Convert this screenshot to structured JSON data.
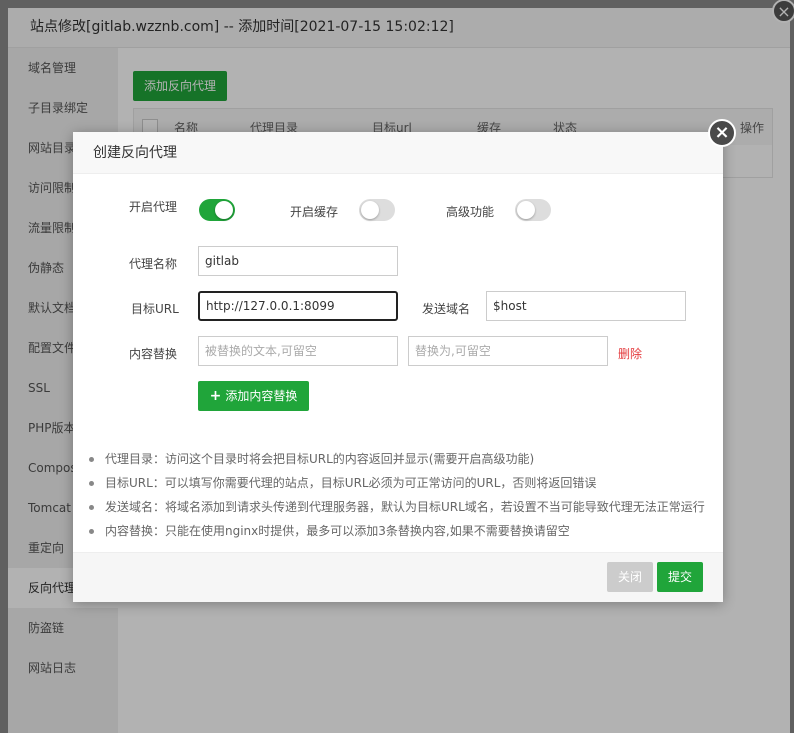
{
  "outer": {
    "title": "站点修改[gitlab.wzznb.com] -- 添加时间[2021-07-15 15:02:12]",
    "close_icon": "close-icon",
    "sidebar": [
      {
        "label": "域名管理"
      },
      {
        "label": "子目录绑定"
      },
      {
        "label": "网站目录"
      },
      {
        "label": "访问限制"
      },
      {
        "label": "流量限制"
      },
      {
        "label": "伪静态"
      },
      {
        "label": "默认文档"
      },
      {
        "label": "配置文件"
      },
      {
        "label": "SSL"
      },
      {
        "label": "PHP版本"
      },
      {
        "label": "Composer"
      },
      {
        "label": "Tomcat"
      },
      {
        "label": "重定向"
      },
      {
        "label": "反向代理"
      },
      {
        "label": "防盗链"
      },
      {
        "label": "网站日志"
      }
    ],
    "add_proxy_label": "添加反向代理",
    "table_headers": [
      "名称",
      "代理目录",
      "目标url",
      "缓存",
      "状态",
      "操作"
    ]
  },
  "modal": {
    "title": "创建反向代理",
    "close_icon": "close-icon",
    "enable_proxy_label": "开启代理",
    "enable_proxy_on": true,
    "enable_cache_label": "开启缓存",
    "enable_cache_on": false,
    "advanced_label": "高级功能",
    "advanced_on": false,
    "proxy_name_label": "代理名称",
    "proxy_name_value": "gitlab",
    "target_url_label": "目标URL",
    "target_url_value": "http://127.0.0.1:8099",
    "send_domain_label": "发送域名",
    "send_domain_value": "$host",
    "content_replace_label": "内容替换",
    "replace_from_placeholder": "被替换的文本,可留空",
    "replace_to_placeholder": "替换为,可留空",
    "delete_label": "删除",
    "add_replace_label": "添加内容替换",
    "notes": [
      "代理目录：访问这个目录时将会把目标URL的内容返回并显示(需要开启高级功能)",
      "目标URL：可以填写你需要代理的站点，目标URL必须为可正常访问的URL，否则将返回错误",
      "发送域名：将域名添加到请求头传递到代理服务器，默认为目标URL域名，若设置不当可能导致代理无法正常运行",
      "内容替换：只能在使用nginx时提供，最多可以添加3条替换内容,如果不需要替换请留空"
    ],
    "close_button_label": "关闭",
    "submit_button_label": "提交"
  },
  "colors": {
    "accent": "#20a53a",
    "danger": "#e4393c",
    "disabled": "#cccccc"
  }
}
